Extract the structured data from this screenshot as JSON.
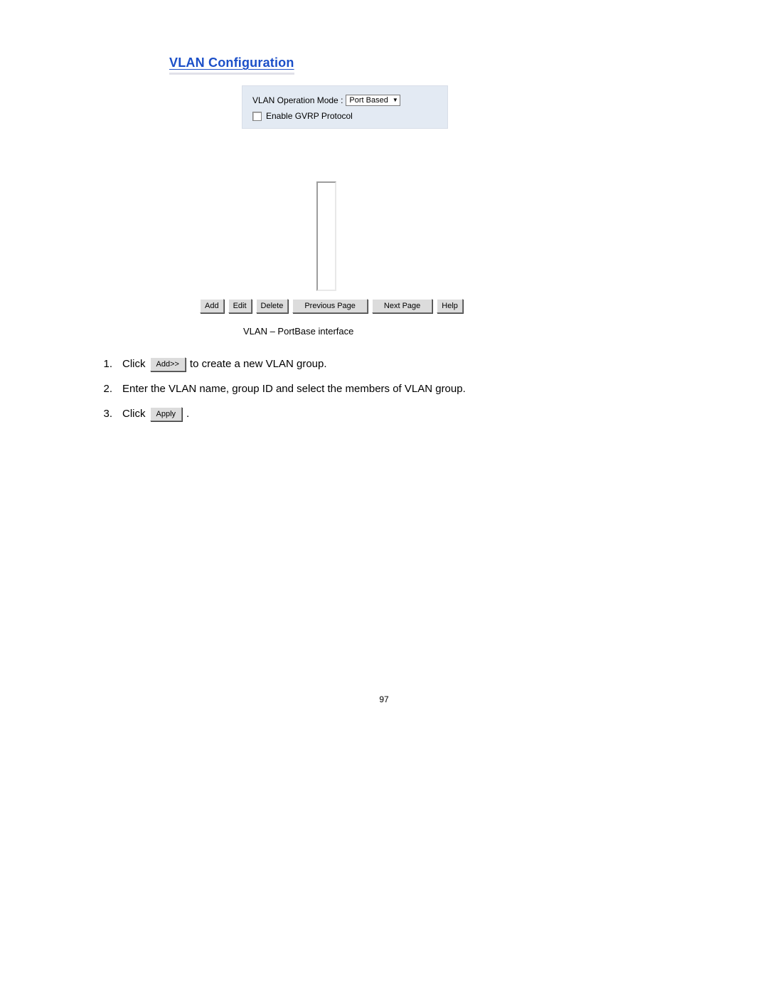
{
  "heading": "VLAN Configuration",
  "panel": {
    "mode_label": "VLAN Operation Mode :",
    "mode_value": "Port Based",
    "gvrp_label": "Enable GVRP Protocol"
  },
  "buttons": {
    "add": "Add",
    "edit": "Edit",
    "delete": "Delete",
    "prev": "Previous Page",
    "next": "Next Page",
    "help": "Help"
  },
  "caption": "VLAN – PortBase interface",
  "steps": {
    "n1": "1.",
    "s1a": "Click",
    "s1_btn": "Add>>",
    "s1b": "to create a new VLAN group.",
    "n2": "2.",
    "s2": "Enter the VLAN name, group ID and select the members of VLAN group.",
    "n3": "3.",
    "s3a": "Click",
    "s3_btn": "Apply",
    "s3b": "."
  },
  "page_number": "97"
}
